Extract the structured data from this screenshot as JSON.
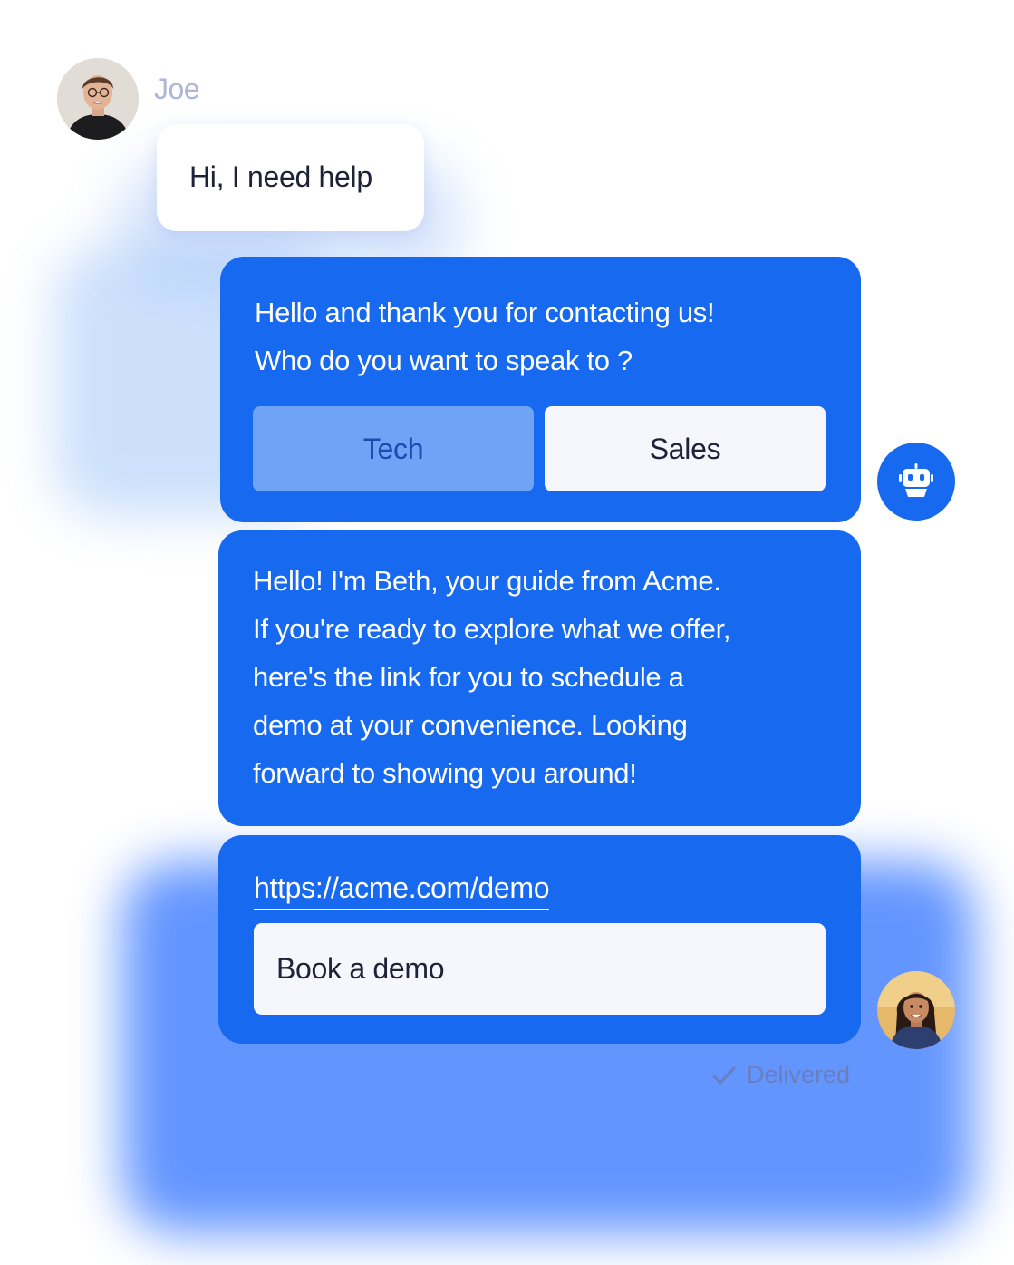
{
  "user": {
    "name": "Joe",
    "message": "Hi, I need help"
  },
  "bot": {
    "greeting_lines": [
      "Hello and thank you for contacting us!",
      "Who do you want to speak to ?"
    ],
    "choices": [
      {
        "label": "Tech",
        "selected": true
      },
      {
        "label": "Sales",
        "selected": false
      }
    ]
  },
  "agent": {
    "message_lines": [
      "Hello! I'm Beth, your guide from Acme.",
      "If you're ready to explore what we offer,",
      "here's the link for you to schedule a",
      "demo at your convenience. Looking",
      "forward to showing you around!"
    ],
    "link": "https://acme.com/demo",
    "button_label": "Book a demo"
  },
  "status": {
    "delivered_label": "Delivered"
  },
  "icons": {
    "bot": "robot-icon",
    "check": "check-icon"
  },
  "colors": {
    "bubble_blue": "#1769f0",
    "selected_choice": "#6ea3f5",
    "light_button": "#f6f7fc",
    "dark_text": "#1d2236"
  }
}
